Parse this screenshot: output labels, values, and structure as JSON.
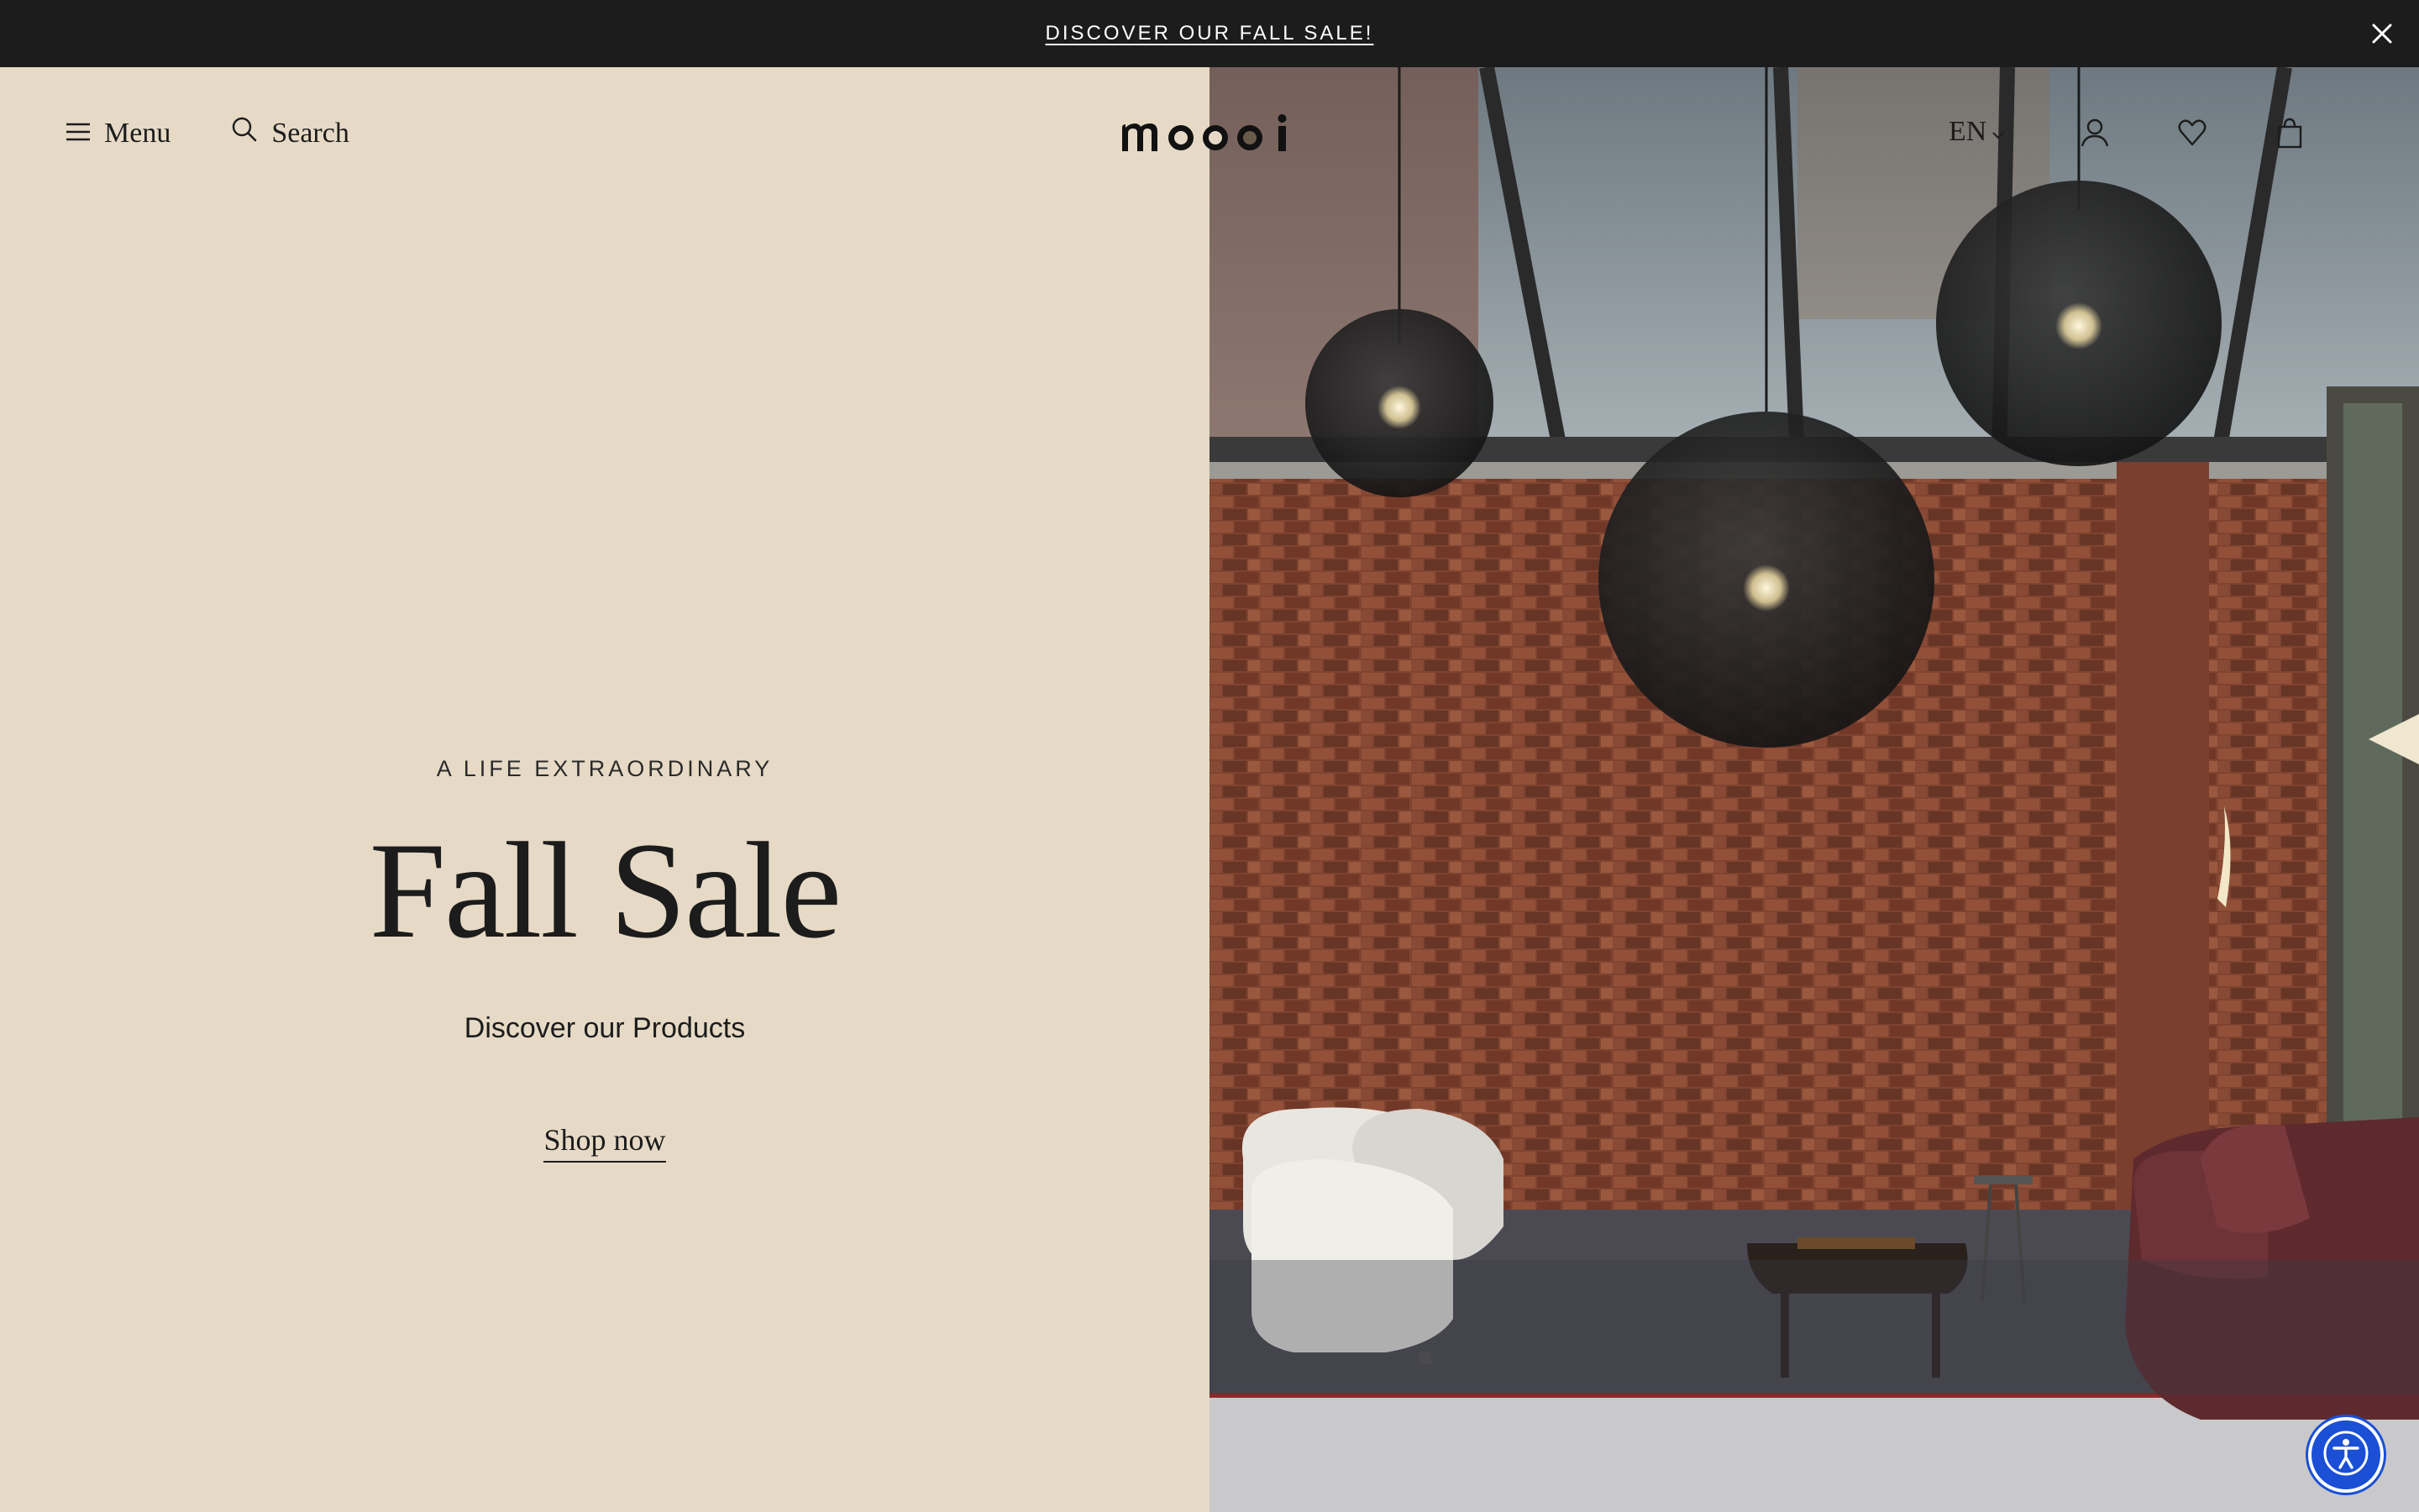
{
  "announcement": {
    "text": "DISCOVER OUR FALL SALE!",
    "close_icon": "close-icon"
  },
  "header": {
    "menu_label": "Menu",
    "menu_icon": "hamburger-icon",
    "search_label": "Search",
    "search_icon": "search-icon",
    "logo_text": "moooi",
    "language": "EN",
    "language_icon": "chevron-down-icon",
    "account_icon": "user-icon",
    "wishlist_icon": "heart-icon",
    "cart_icon": "shopping-bag-icon"
  },
  "hero": {
    "eyebrow": "A LIFE EXTRAORDINARY",
    "headline": "Fall Sale",
    "subheading": "Discover our Products",
    "cta_label": "Shop now"
  },
  "accessibility": {
    "icon": "accessibility-icon"
  },
  "colors": {
    "announcement_bg": "#1c1c1c",
    "panel_bg": "#e6dac6",
    "text": "#1c1c1c",
    "accessibility_bg": "#1a4fd6"
  }
}
